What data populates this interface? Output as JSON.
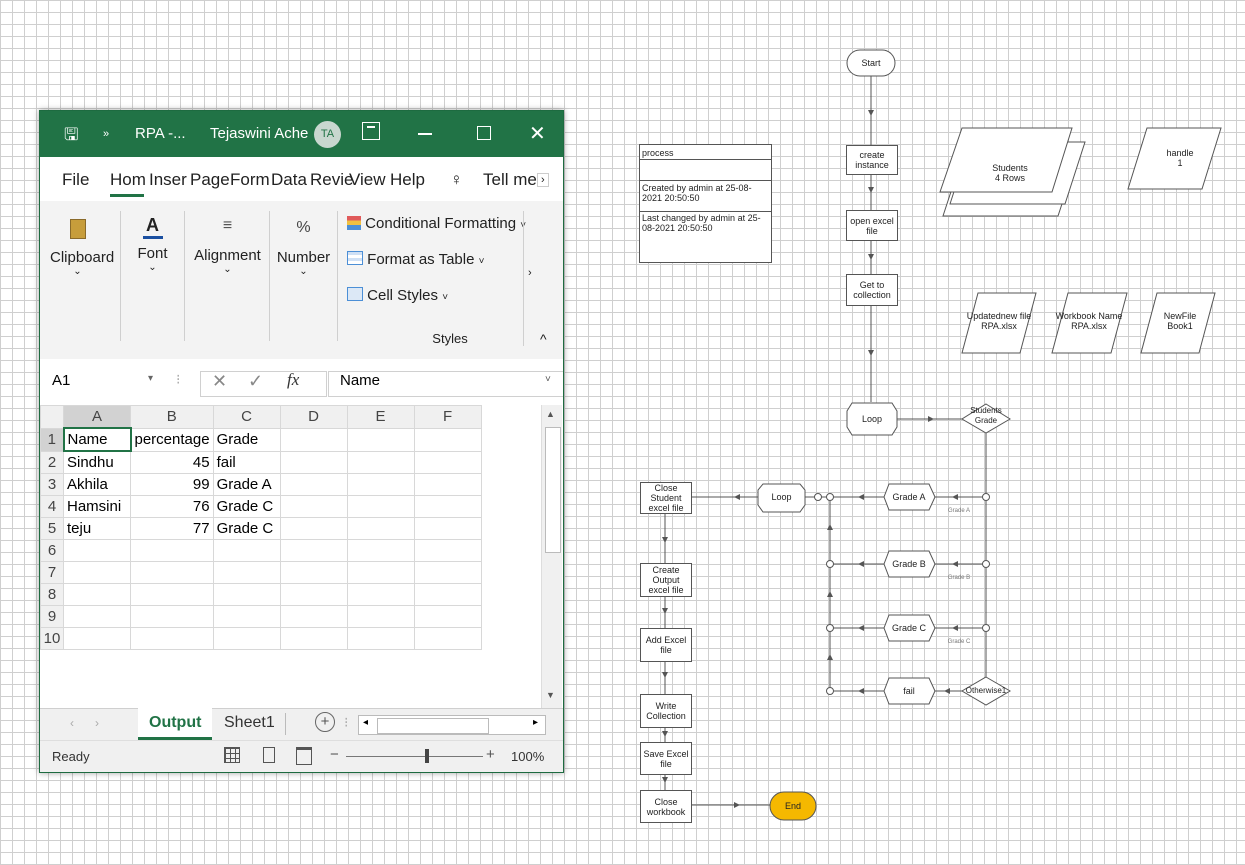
{
  "excel": {
    "title": "RPA -...",
    "user": "Tejaswini Ache",
    "user_initials": "TA",
    "quick_save_icon": "save-icon",
    "tabs": [
      "File",
      "Hom",
      "Inser",
      "Page",
      "Form",
      "Data",
      "Revie",
      "View",
      "Help"
    ],
    "tell_me": "Tell me",
    "ribbon": {
      "clipboard": "Clipboard",
      "font": "Font",
      "alignment": "Alignment",
      "number": "Number",
      "conditional_formatting": "Conditional Formatting",
      "format_as_table": "Format as Table",
      "cell_styles": "Cell Styles",
      "styles_group": "Styles"
    },
    "name_box": "A1",
    "formula_value": "Name",
    "columns": [
      "A",
      "B",
      "C",
      "D",
      "E",
      "F"
    ],
    "rows": [
      {
        "n": "1",
        "a": "Name",
        "b": "percentage",
        "c": "Grade"
      },
      {
        "n": "2",
        "a": "Sindhu",
        "b": "45",
        "c": "fail"
      },
      {
        "n": "3",
        "a": "Akhila",
        "b": "99",
        "c": "Grade A"
      },
      {
        "n": "4",
        "a": "Hamsini",
        "b": "76",
        "c": "Grade C"
      },
      {
        "n": "5",
        "a": "teju",
        "b": "77",
        "c": "Grade C"
      },
      {
        "n": "6",
        "a": "",
        "b": "",
        "c": ""
      },
      {
        "n": "7",
        "a": "",
        "b": "",
        "c": ""
      },
      {
        "n": "8",
        "a": "",
        "b": "",
        "c": ""
      },
      {
        "n": "9",
        "a": "",
        "b": "",
        "c": ""
      },
      {
        "n": "10",
        "a": "",
        "b": "",
        "c": ""
      }
    ],
    "sheets": [
      "Output",
      "Sheet1"
    ],
    "status": "Ready",
    "zoom": "100%",
    "accent": "#217346"
  },
  "flow": {
    "start": "Start",
    "end": "End",
    "info_title": "process",
    "info_created": "Created by admin at 25-08-2021 20:50:50",
    "info_changed": "Last changed by admin at 25-08-2021 20:50:50",
    "create_instance": "create instance",
    "open_excel": "open excel file",
    "get_collection": "Get to collection",
    "loop1": "Loop",
    "students_grade": "Students Grade",
    "students_data": "Students",
    "students_rows": "4 Rows",
    "handle": "handle",
    "handle_val": "1",
    "updated_file": "Updatednew file",
    "updated_file_val": "RPA.xlsx",
    "workbook_name": "Workbook Name",
    "workbook_name_val": "RPA.xlsx",
    "newfile": "NewFile",
    "newfile_val": "Book1",
    "grade_a": "Grade A",
    "grade_b": "Grade B",
    "grade_c": "Grade C",
    "fail": "fail",
    "otherwise": "Otherwise1",
    "grade_a_small": "Grade A",
    "grade_b_small": "Grade B",
    "grade_c_small": "Grade C",
    "loop2": "Loop",
    "close_student": "Close Student excel file",
    "create_output": "Create Output excel file",
    "add_excel": "Add Excel file",
    "write_collection": "Write Collection",
    "save_excel": "Save Excel file",
    "close_workbook": "Close workbook",
    "end_color": "#f5b800"
  }
}
